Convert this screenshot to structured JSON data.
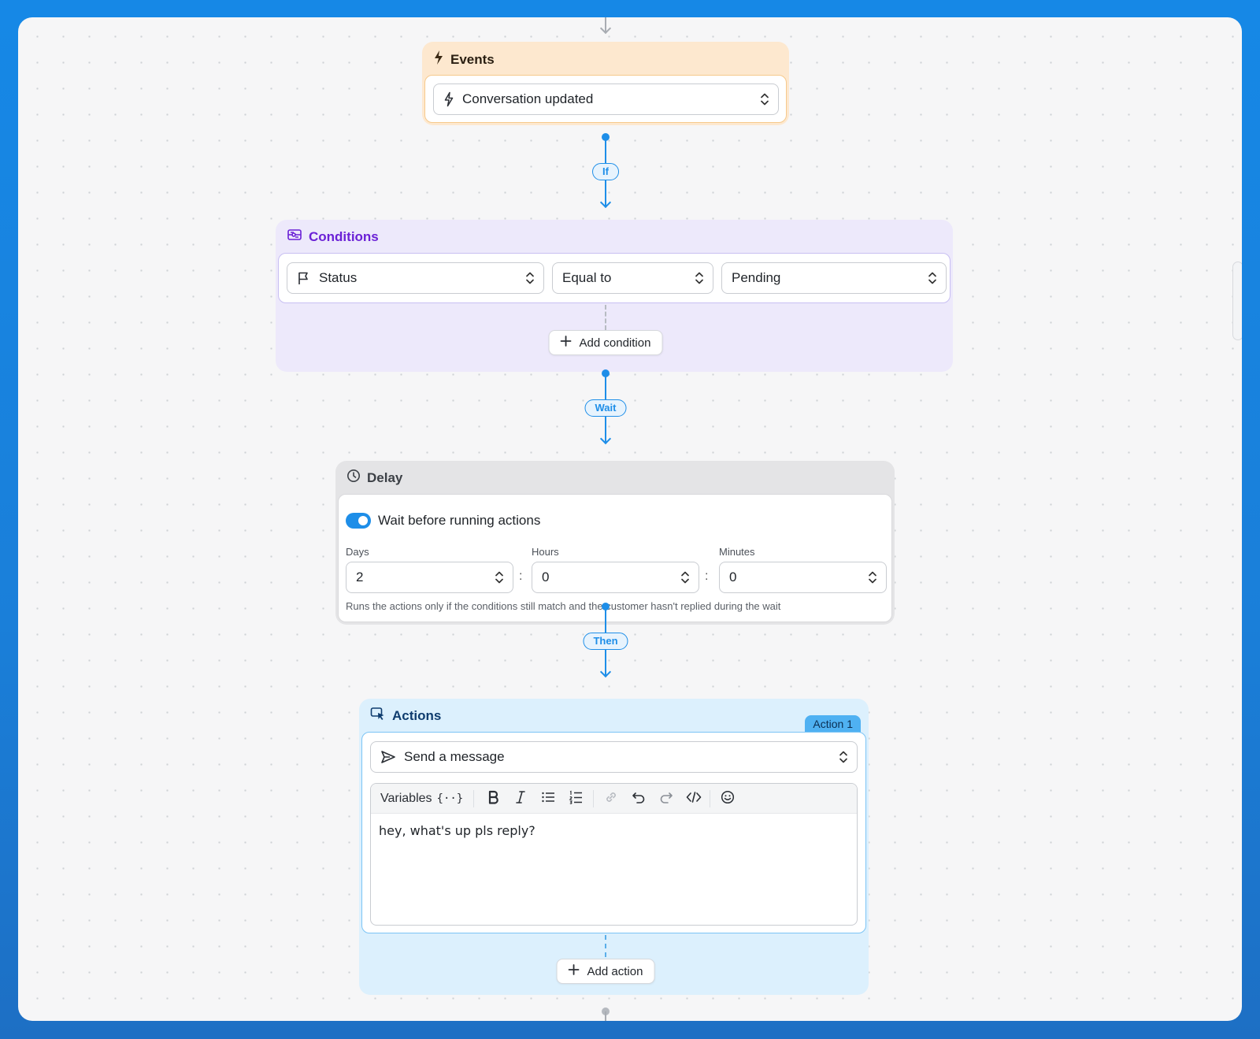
{
  "events": {
    "title": "Events",
    "trigger_value": "Conversation updated"
  },
  "connectors": {
    "if_label": "If",
    "wait_label": "Wait",
    "then_label": "Then"
  },
  "conditions": {
    "title": "Conditions",
    "field_value": "Status",
    "operator_value": "Equal to",
    "value_value": "Pending",
    "add_label": "Add condition"
  },
  "delay": {
    "title": "Delay",
    "toggle_label": "Wait before running actions",
    "toggle_on": true,
    "days_label": "Days",
    "days_value": "2",
    "hours_label": "Hours",
    "hours_value": "0",
    "minutes_label": "Minutes",
    "minutes_value": "0",
    "separator": ":",
    "help_text": "Runs the actions only if the conditions still match and the customer hasn't replied during the wait"
  },
  "actions": {
    "title": "Actions",
    "badge": "Action 1",
    "action_value": "Send a message",
    "variables_label": "Variables",
    "variables_glyph": "{··}",
    "message_text": "hey, what's up pls reply?",
    "add_label": "Add action"
  },
  "colors": {
    "accent": "#1e8ee8",
    "events_bg": "#fde8cf",
    "events_border": "#f6c98c",
    "conditions_bg": "#ede9fb",
    "conditions_title": "#6b21d6",
    "delay_bg": "#e4e4e6",
    "actions_bg": "#dcf0fd",
    "actions_title": "#0f3c6e"
  }
}
